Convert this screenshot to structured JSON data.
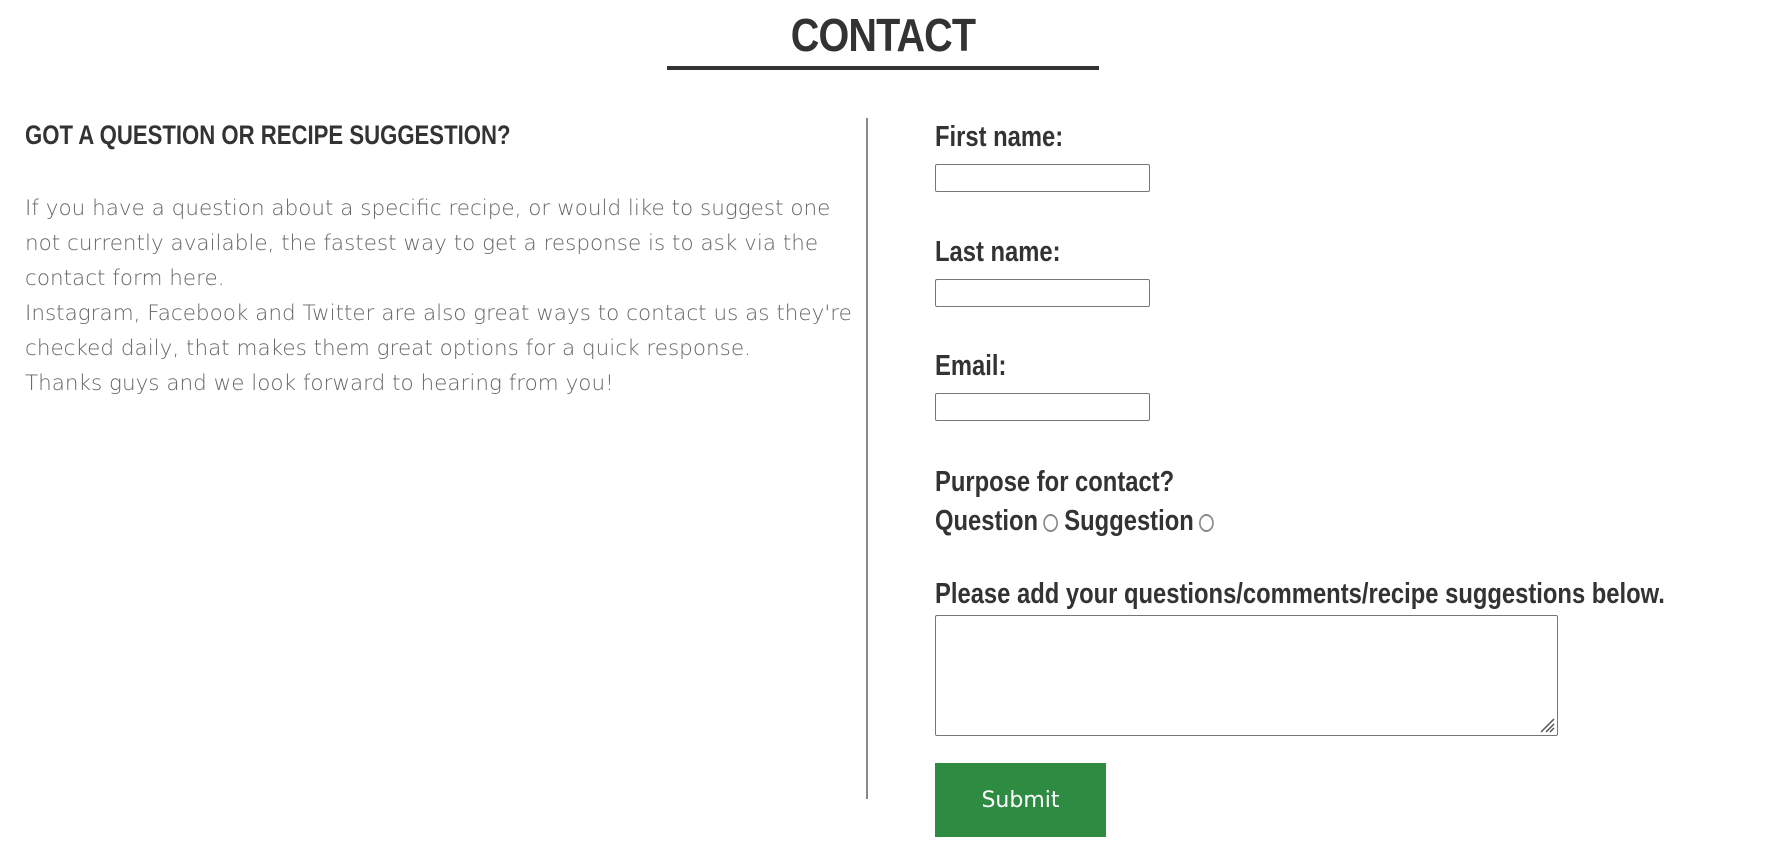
{
  "header": {
    "title": "CONTACT"
  },
  "intro": {
    "heading": "GOT A QUESTION OR RECIPE SUGGESTION?",
    "paragraphs": [
      "If you have a question about a specific recipe, or would like to suggest one not currently available, the fastest way to get a response is to ask via the contact form here.",
      "Instagram, Facebook and Twitter are also great ways to contact us as they're checked daily, that makes them great options for a quick response.",
      "Thanks guys and we look forward to hearing from you!"
    ]
  },
  "form": {
    "first_name": {
      "label": "First name:",
      "value": ""
    },
    "last_name": {
      "label": "Last name:",
      "value": ""
    },
    "email": {
      "label": "Email:",
      "value": ""
    },
    "purpose": {
      "label": "Purpose for contact?",
      "options": [
        "Question",
        "Suggestion"
      ],
      "selected": null
    },
    "comments": {
      "label": "Please add your questions/comments/recipe suggestions below.",
      "value": ""
    },
    "submit_label": "Submit"
  },
  "colors": {
    "text": "#333333",
    "body_text": "#666666",
    "submit_bg": "#2e8b42",
    "submit_text": "#ffffff"
  }
}
